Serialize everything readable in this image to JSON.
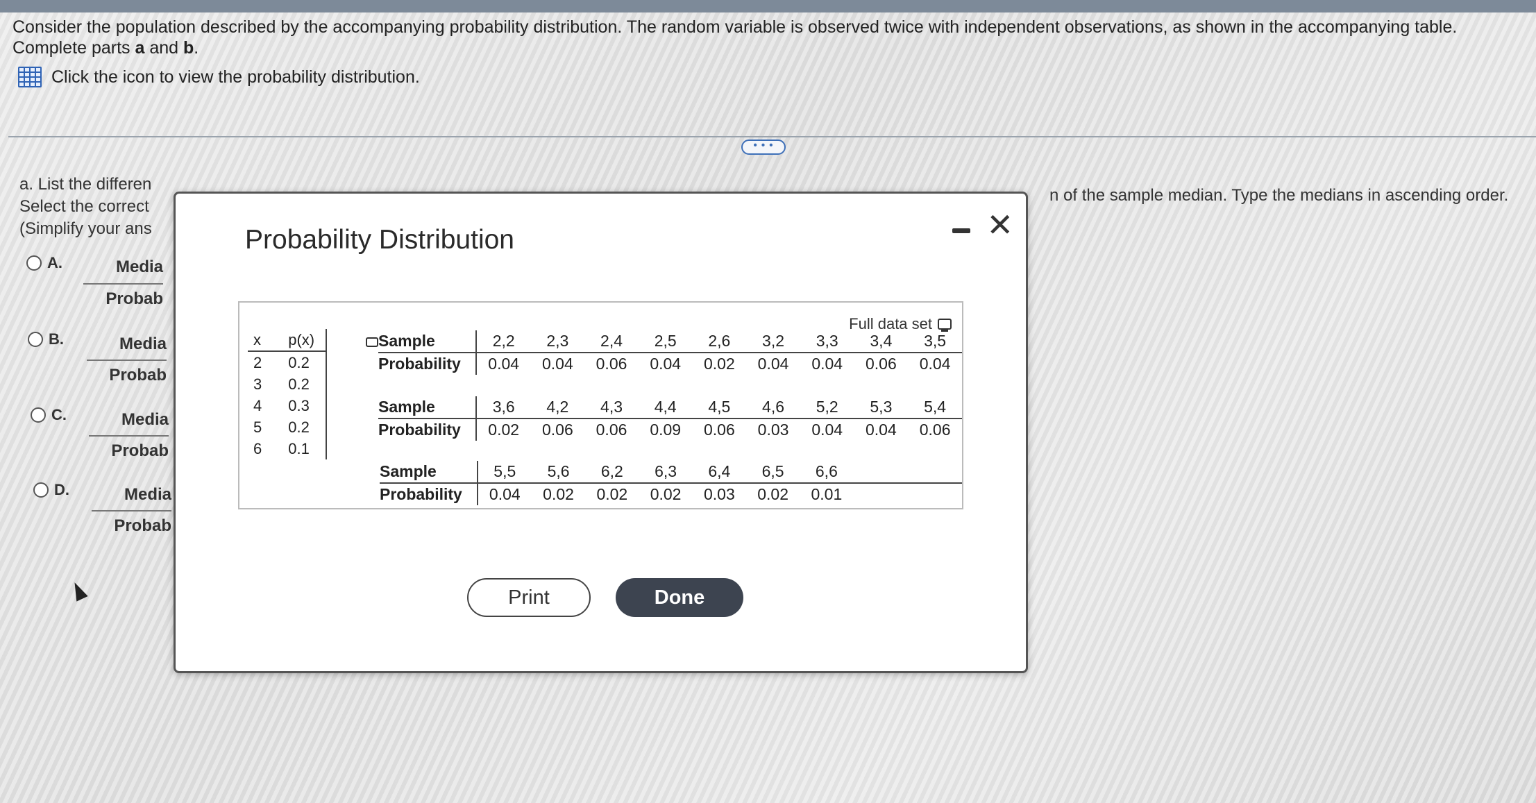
{
  "prompt": {
    "line1": "Consider the population described by the accompanying probability distribution. The random variable is observed twice with independent observations, as shown in the accompanying table.",
    "line2_pre": "Complete parts ",
    "line2_a": "a",
    "line2_mid": " and ",
    "line2_b": "b",
    "line2_post": ".",
    "click_text": "Click the icon to view the probability distribution."
  },
  "more_button": "• • •",
  "part_a": {
    "line1": "a. List the differen",
    "line2": "Select the correct",
    "line3": "(Simplify your ans",
    "right_text": "n of the sample median. Type the medians in ascending order."
  },
  "options": [
    {
      "label": "A.",
      "median": "Media",
      "prob": "Probab"
    },
    {
      "label": "B.",
      "median": "Media",
      "prob": "Probab"
    },
    {
      "label": "C.",
      "median": "Media",
      "prob": "Probab"
    },
    {
      "label": "D.",
      "median": "Media",
      "prob": "Probab"
    }
  ],
  "modal": {
    "title": "Probability Distribution",
    "minimize_icon": "minimize-icon",
    "close_glyph": "✕",
    "full_data_label": "Full data set",
    "px_table": {
      "headers": [
        "x",
        "p(x)"
      ],
      "rows": [
        [
          "2",
          "0.2"
        ],
        [
          "3",
          "0.2"
        ],
        [
          "4",
          "0.3"
        ],
        [
          "5",
          "0.2"
        ],
        [
          "6",
          "0.1"
        ]
      ]
    },
    "sample_label": "Sample",
    "prob_label": "Probability",
    "groups": [
      {
        "samples": [
          "2,2",
          "2,3",
          "2,4",
          "2,5",
          "2,6",
          "3,2",
          "3,3",
          "3,4",
          "3,5"
        ],
        "probs": [
          "0.04",
          "0.04",
          "0.06",
          "0.04",
          "0.02",
          "0.04",
          "0.04",
          "0.06",
          "0.04"
        ]
      },
      {
        "samples": [
          "3,6",
          "4,2",
          "4,3",
          "4,4",
          "4,5",
          "4,6",
          "5,2",
          "5,3",
          "5,4"
        ],
        "probs": [
          "0.02",
          "0.06",
          "0.06",
          "0.09",
          "0.06",
          "0.03",
          "0.04",
          "0.04",
          "0.06"
        ]
      },
      {
        "samples": [
          "5,5",
          "5,6",
          "6,2",
          "6,3",
          "6,4",
          "6,5",
          "6,6"
        ],
        "probs": [
          "0.04",
          "0.02",
          "0.02",
          "0.02",
          "0.03",
          "0.02",
          "0.01"
        ]
      }
    ],
    "print_label": "Print",
    "done_label": "Done"
  }
}
